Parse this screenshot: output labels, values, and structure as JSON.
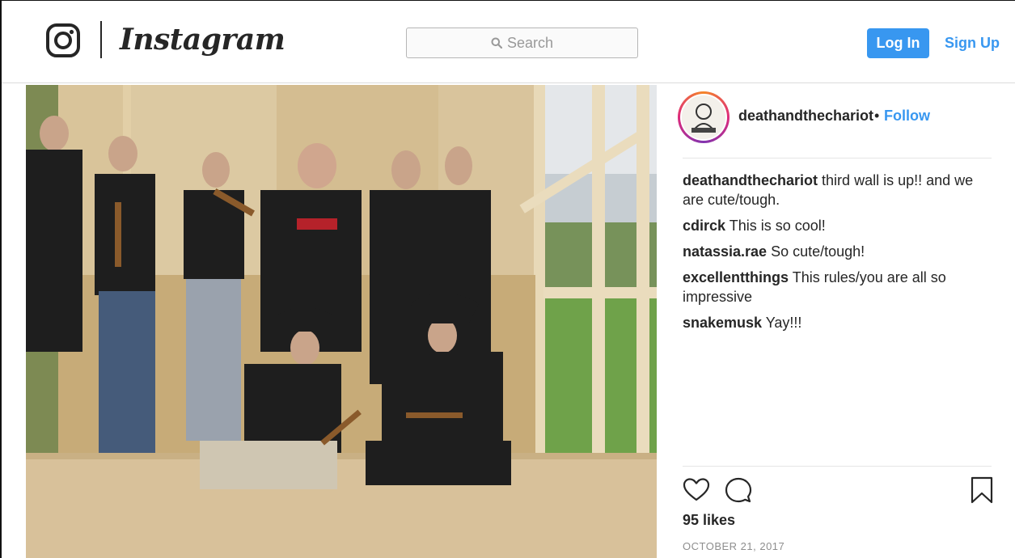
{
  "header": {
    "wordmark": "Instagram",
    "search_placeholder": "Search",
    "login_label": "Log In",
    "signup_label": "Sign Up",
    "accent_color": "#3897f0"
  },
  "post": {
    "username": "deathandthechariot",
    "separator": "•",
    "follow_label": "Follow",
    "comments": [
      {
        "user": "deathandthechariot",
        "text": "third wall is up!! and we are cute/tough."
      },
      {
        "user": "cdirck",
        "text": "This is so cool!"
      },
      {
        "user": "natassia.rae",
        "text": "So cute/tough!"
      },
      {
        "user": "excellentthings",
        "text": "This rules/you are all so impressive"
      },
      {
        "user": "snakemusk",
        "text": "Yay!!!"
      }
    ],
    "likes": "95 likes",
    "date": "OCTOBER 21, 2017"
  },
  "icons": {
    "logo": "instagram-camera-icon",
    "search": "search-icon",
    "like": "heart-icon",
    "comment": "comment-bubble-icon",
    "save": "bookmark-icon"
  }
}
